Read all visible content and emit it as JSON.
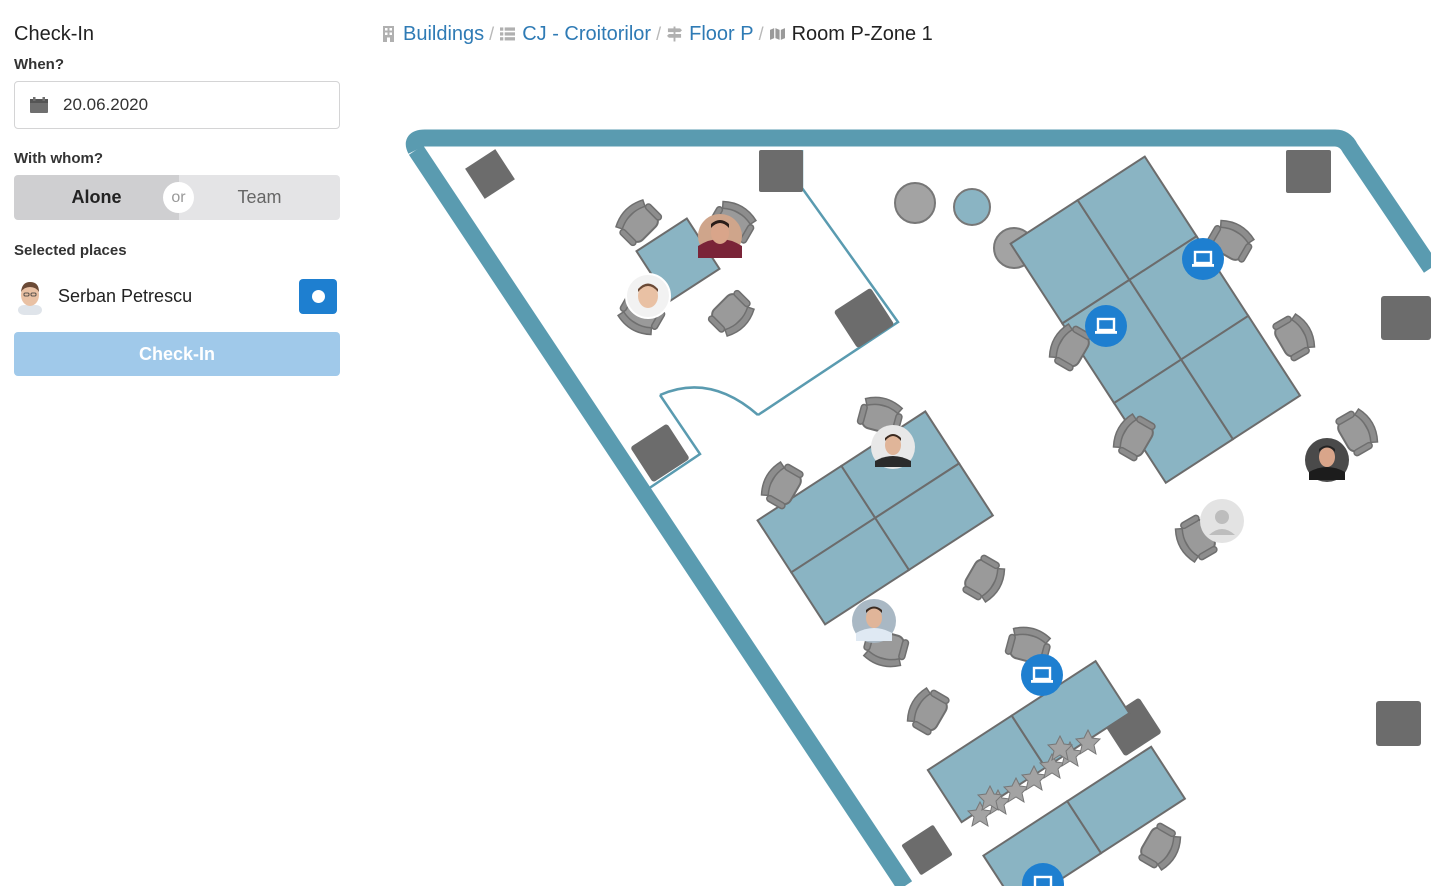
{
  "checkin": {
    "title": "Check-In",
    "when_label": "When?",
    "date_value": "20.06.2020",
    "with_whom_label": "With whom?",
    "option_alone": "Alone",
    "option_or": "or",
    "option_team": "Team",
    "selected_option": "Alone",
    "selected_places_label": "Selected places",
    "selected_place_name": "Serban Petrescu",
    "selected_place_checked": true,
    "button_label": "Check-In",
    "button_enabled": false
  },
  "breadcrumb": {
    "items": [
      {
        "label": "Buildings",
        "icon": "building-icon"
      },
      {
        "label": "CJ - Croitorilor",
        "icon": "list-icon"
      },
      {
        "label": "Floor P",
        "icon": "signpost-icon"
      },
      {
        "label": "Room P-Zone 1",
        "icon": "map-icon"
      }
    ],
    "separator": "/"
  },
  "colors": {
    "accent": "#1e7fd0",
    "link": "#2f7bb5",
    "wall": "#5a9bb0",
    "desk": "#8ab4c3",
    "pillar": "#6c6c6c",
    "chair": "#9a9a9a",
    "button_disabled": "#a0c9ea"
  }
}
